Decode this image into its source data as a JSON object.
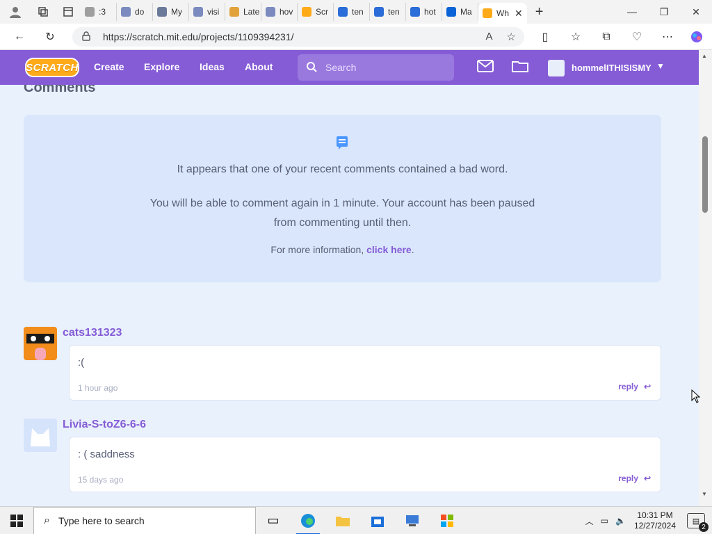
{
  "browser": {
    "tabs": [
      {
        "label": ":3",
        "color": "#9e9e9e"
      },
      {
        "label": "do",
        "color": "#7b8bbf"
      },
      {
        "label": "My",
        "color": "#6b7a99"
      },
      {
        "label": "visi",
        "color": "#7b8bbf"
      },
      {
        "label": "Late",
        "color": "#e2a23b"
      },
      {
        "label": "hov",
        "color": "#7b8bbf"
      },
      {
        "label": "Scr",
        "color": "#ffab19"
      },
      {
        "label": "ten",
        "color": "#2a6cd8"
      },
      {
        "label": "ten",
        "color": "#2a6cd8"
      },
      {
        "label": "hot",
        "color": "#2a6cd8"
      },
      {
        "label": "Ma",
        "color": "#0a64d8"
      },
      {
        "label": "Wh",
        "color": "#ffab19"
      }
    ],
    "url": "https://scratch.mit.edu/projects/1109394231/"
  },
  "nav": {
    "logo": "SCRATCH",
    "links": [
      "Create",
      "Explore",
      "Ideas",
      "About"
    ],
    "search_placeholder": "Search",
    "username": "hommelITHISISMY"
  },
  "comments": {
    "title": "Comments",
    "notice": {
      "line1": "It appears that one of your recent comments contained a bad word.",
      "line2": "You will be able to comment again in 1 minute. Your account has been paused from commenting until then.",
      "line3_prefix": "For more information, ",
      "line3_link": "click here",
      "line3_suffix": "."
    },
    "items": [
      {
        "user": "cats131323",
        "text": ":(",
        "time": "1 hour ago",
        "reply": "reply"
      },
      {
        "user": "Livia-S-toZ6-6-6",
        "text": ": ( saddness",
        "time": "15 days ago",
        "reply": "reply"
      }
    ]
  },
  "taskbar": {
    "search_placeholder": "Type here to search",
    "time": "10:31 PM",
    "date": "12/27/2024",
    "notifications": "2"
  }
}
